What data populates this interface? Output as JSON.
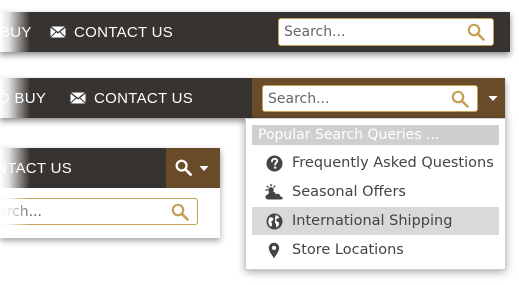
{
  "nav": {
    "buy_label": "BUY",
    "buy_label_clipped": "O BUY",
    "contact_label": "CONTACT US",
    "contact_label_clipped": "NTACT US"
  },
  "search": {
    "placeholder": "Search...",
    "placeholder_clipped": "arch..."
  },
  "dropdown": {
    "header": "Popular Search Queries ...",
    "items": [
      {
        "label": "Frequently Asked Questions",
        "icon": "question-circle-icon"
      },
      {
        "label": "Seasonal Offers",
        "icon": "weather-cloud-sun-icon"
      },
      {
        "label": "International Shipping",
        "icon": "globe-icon",
        "active": true
      },
      {
        "label": "Store Locations",
        "icon": "map-marker-icon"
      }
    ]
  },
  "colors": {
    "bar_bg": "#373330",
    "accent_brown": "#6b4c2a",
    "search_border": "#c6a056",
    "icon_gold": "#c6a056",
    "dropdown_header_bg": "#cfcfcf",
    "active_item_bg": "#d9d9d9"
  }
}
